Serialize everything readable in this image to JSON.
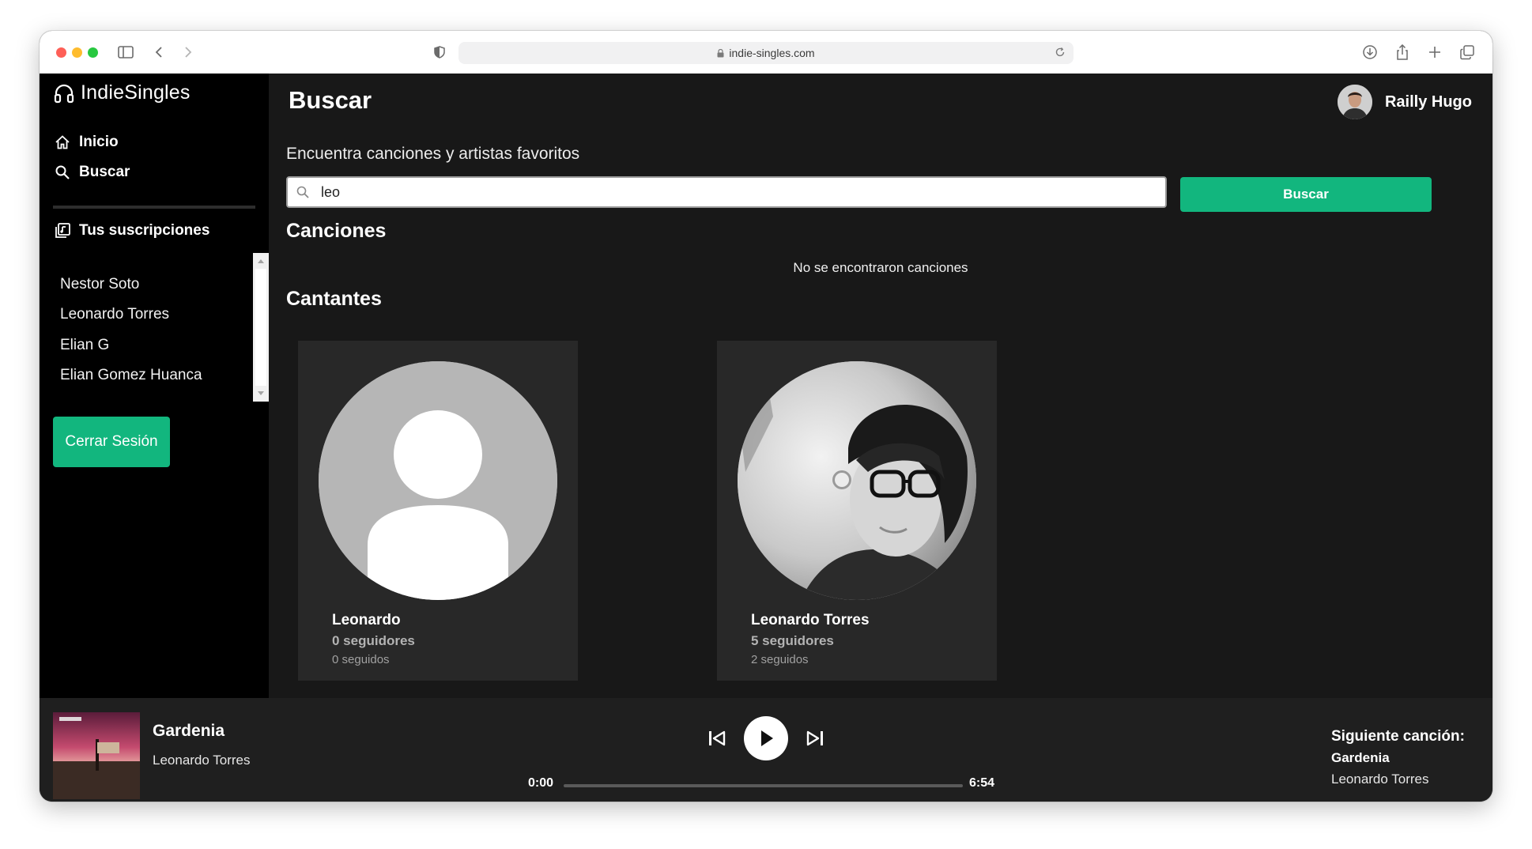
{
  "browser": {
    "url": "indie-singles.com"
  },
  "app": {
    "brand": "IndieSingles",
    "nav": {
      "home": "Inicio",
      "search": "Buscar",
      "subscriptions": "Tus suscripciones"
    },
    "subscriptions": [
      "Nestor Soto",
      "Leonardo Torres",
      "Elian G",
      "Elian Gomez Huanca"
    ],
    "logout_label": "Cerrar Sesión",
    "accent_color": "#12b67e"
  },
  "header": {
    "title": "Buscar",
    "user_name": "Railly Hugo"
  },
  "search": {
    "subtitle": "Encuentra canciones y artistas favoritos",
    "query": "leo",
    "button_label": "Buscar"
  },
  "results": {
    "songs_title": "Canciones",
    "songs_empty": "No se encontraron canciones",
    "singers_title": "Cantantes",
    "singers": [
      {
        "name": "Leonardo",
        "followers": "0 seguidores",
        "following": "0 seguidos"
      },
      {
        "name": "Leonardo Torres",
        "followers": "5 seguidores",
        "following": "2 seguidos"
      }
    ]
  },
  "player": {
    "title": "Gardenia",
    "artist": "Leonardo Torres",
    "current_time": "0:00",
    "total_time": "6:54",
    "progress": 0,
    "next_label": "Siguiente canción:",
    "next_title": "Gardenia",
    "next_artist": "Leonardo Torres"
  }
}
